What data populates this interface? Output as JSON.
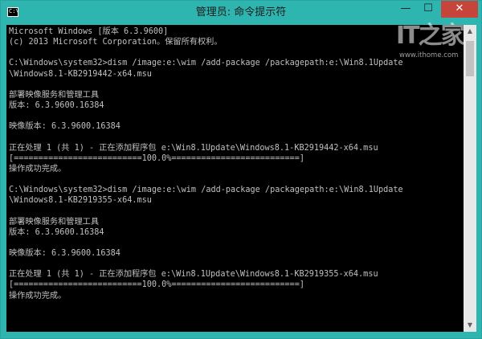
{
  "window": {
    "title": "管理员: 命令提示符",
    "icon": "cmd-icon",
    "icon_glyph": "C:\\",
    "controls": {
      "minimize_glyph": "—",
      "maximize_glyph": "☐",
      "close_glyph": "✕"
    }
  },
  "watermark": {
    "logo": "IT之家",
    "url": "www.ithome.com"
  },
  "console": {
    "lines": [
      "Microsoft Windows [版本 6.3.9600]",
      "(c) 2013 Microsoft Corporation。保留所有权利。",
      "",
      "C:\\Windows\\system32>dism /image:e:\\wim /add-package /packagepath:e:\\Win8.1Update",
      "\\Windows8.1-KB2919442-x64.msu",
      "",
      "部署映像服务和管理工具",
      "版本: 6.3.9600.16384",
      "",
      "映像版本: 6.3.9600.16384",
      "",
      "正在处理 1 (共 1) - 正在添加程序包 e:\\Win8.1Update\\Windows8.1-KB2919442-x64.msu",
      "[==========================100.0%==========================]",
      "操作成功完成。",
      "",
      "C:\\Windows\\system32>dism /image:e:\\wim /add-package /packagepath:e:\\Win8.1Update",
      "\\Windows8.1-KB2919355-x64.msu",
      "",
      "部署映像服务和管理工具",
      "版本: 6.3.9600.16384",
      "",
      "映像版本: 6.3.9600.16384",
      "",
      "正在处理 1 (共 1) - 正在添加程序包 e:\\Win8.1Update\\Windows8.1-KB2919355-x64.msu",
      "[==========================100.0%==========================]",
      "操作成功完成。"
    ]
  },
  "scrollbar": {
    "up_glyph": "▲",
    "down_glyph": "▼"
  },
  "colors": {
    "titlebar": "#2fb5b0",
    "console_bg": "#000000",
    "console_text": "#c0c0c0",
    "close_button": "#c7443a"
  }
}
